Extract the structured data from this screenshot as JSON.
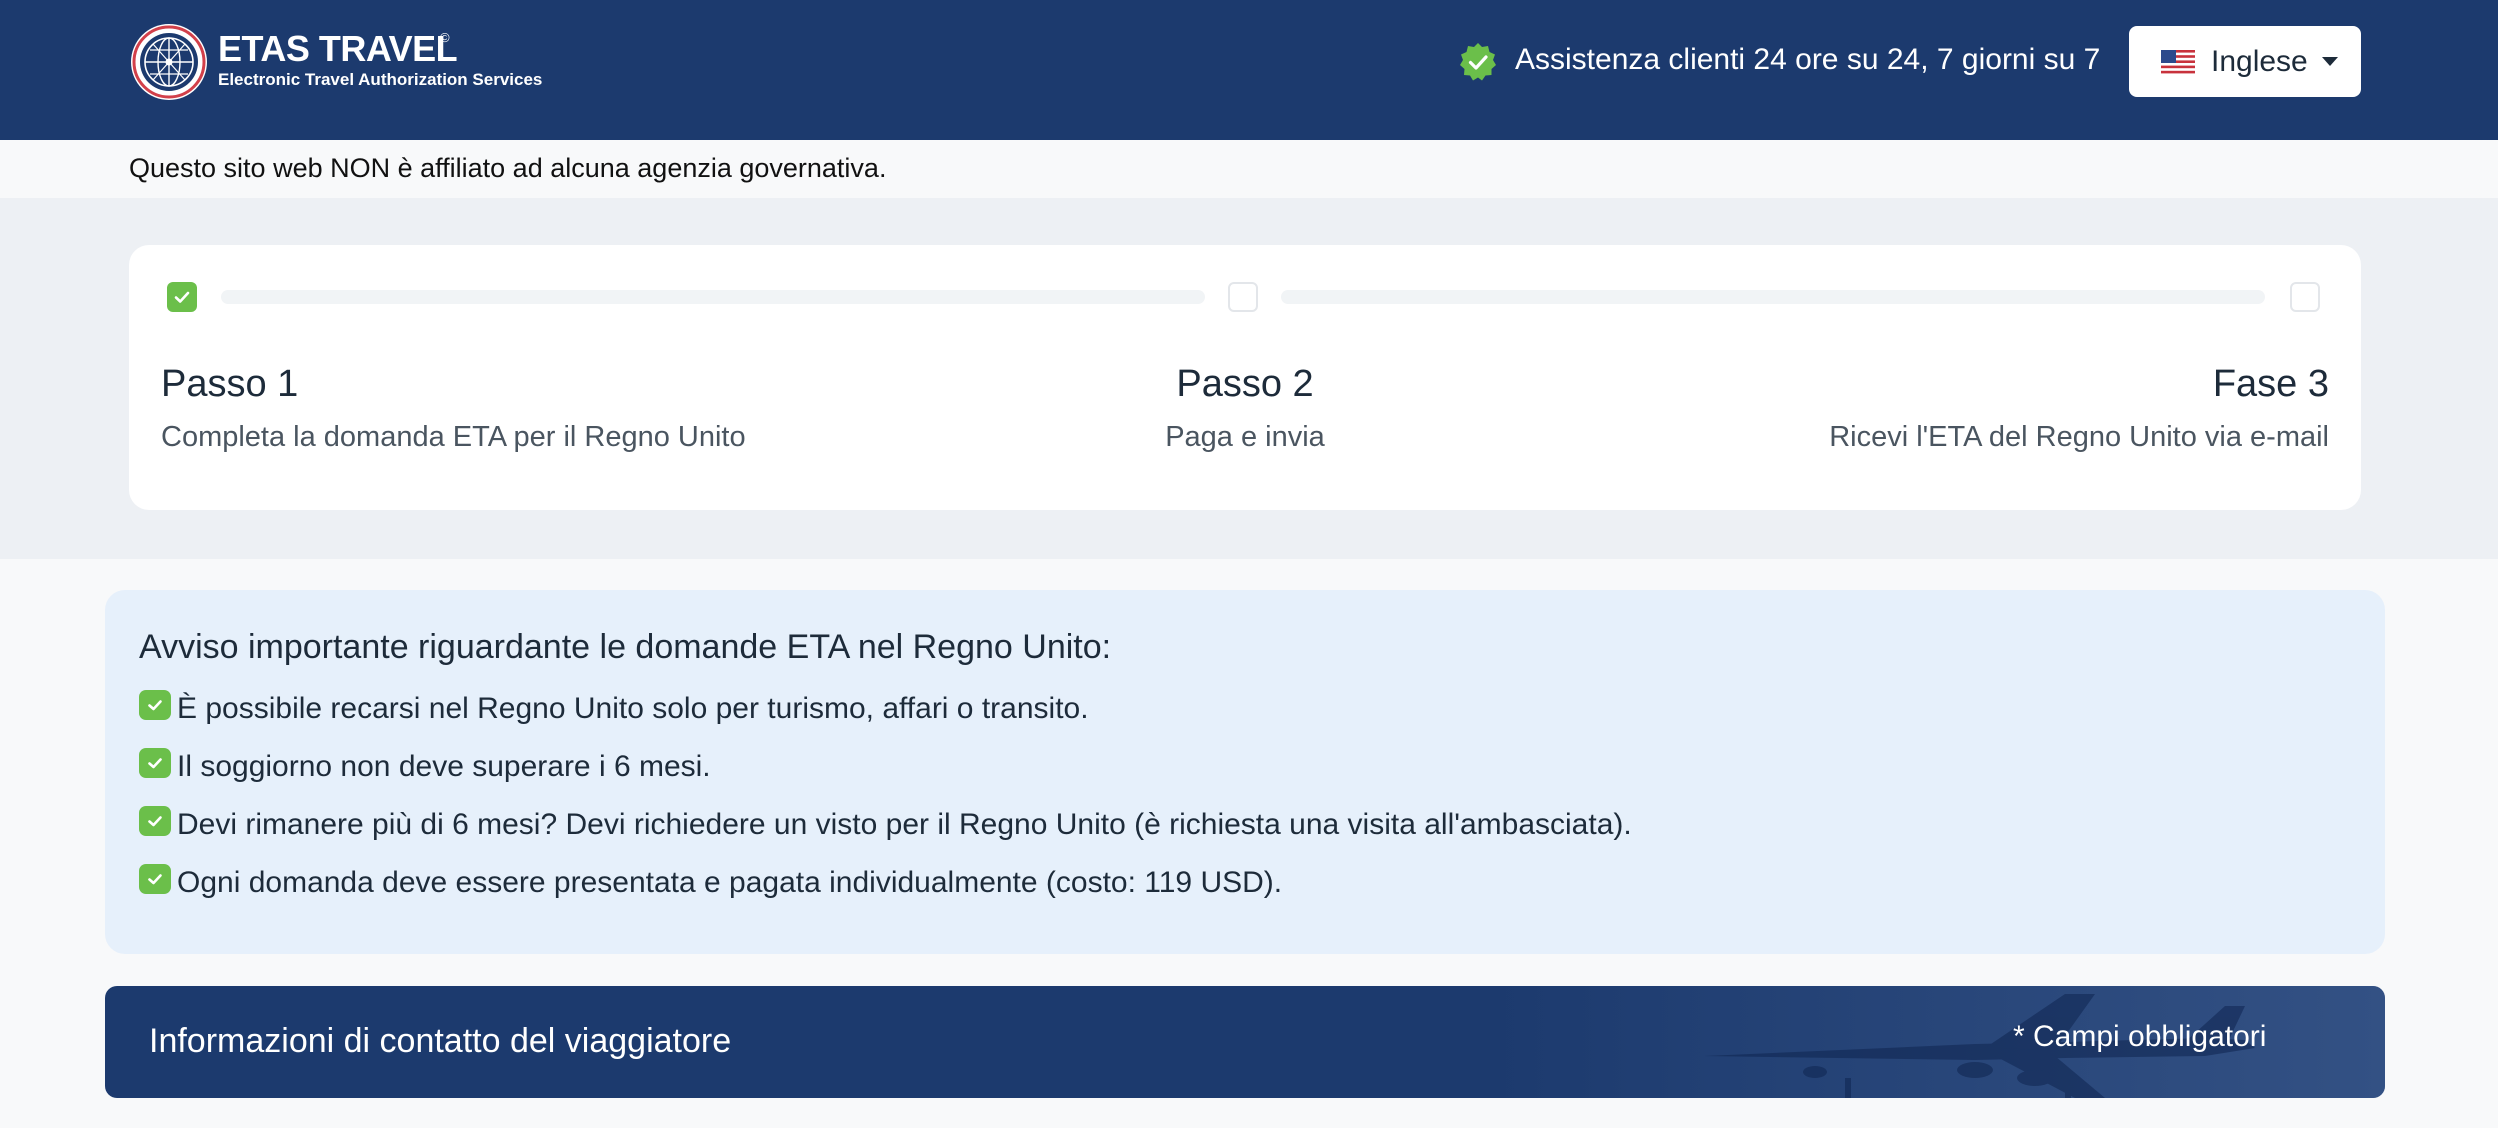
{
  "header": {
    "brand_name": "ETAS TRAVEL",
    "brand_registered": "©",
    "brand_tagline": "Electronic Travel Authorization Services",
    "support_text": "Assistenza clienti 24 ore su 24, 7 giorni su 7",
    "language_selected": "Inglese",
    "colors": {
      "background": "#1c3a6e",
      "accent_green": "#6bbf4a"
    },
    "icons": {
      "logo": "globe-logo-icon",
      "support": "verified-badge-icon",
      "language": "us-flag-icon",
      "dropdown": "caret-down-icon"
    }
  },
  "disclaimer": "Questo sito web NON è affiliato ad alcuna agenzia governativa.",
  "steps": [
    {
      "title": "Passo 1",
      "description": "Completa la domanda ETA per il Regno Unito",
      "completed": true
    },
    {
      "title": "Passo 2",
      "description": "Paga e invia",
      "completed": false
    },
    {
      "title": "Fase 3",
      "description": "Ricevi l'ETA del Regno Unito via e-mail",
      "completed": false
    }
  ],
  "notice": {
    "title": "Avviso importante riguardante le domande ETA nel Regno Unito:",
    "items": [
      "È possibile recarsi nel Regno Unito solo per turismo, affari o transito.",
      "Il soggiorno non deve superare i 6 mesi.",
      "Devi rimanere più di 6 mesi? Devi richiedere un visto per il Regno Unito (è richiesta una visita all'ambasciata).",
      "Ogni domanda deve essere presentata e pagata individualmente (costo: 119 USD)."
    ]
  },
  "contact_section": {
    "title": "Informazioni di contatto del viaggiatore",
    "required_note": "* Campi obbligatori"
  }
}
